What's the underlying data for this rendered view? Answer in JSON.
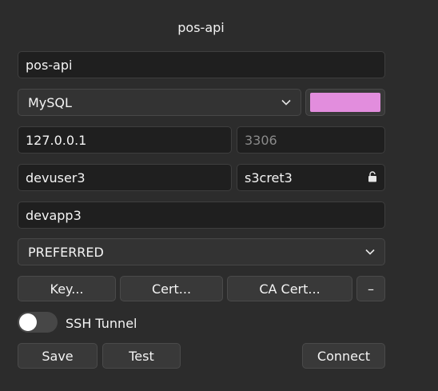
{
  "window": {
    "title": "pos-api"
  },
  "form": {
    "name": {
      "value": "pos-api"
    },
    "driver": {
      "selected": "MySQL",
      "icon": "chevron-down-icon"
    },
    "color": {
      "value": "#e28ddd"
    },
    "host": {
      "value": "127.0.0.1"
    },
    "port": {
      "placeholder": "3306",
      "value": ""
    },
    "user": {
      "value": "devuser3"
    },
    "password": {
      "value": "s3cret3",
      "icon": "lock-icon"
    },
    "database": {
      "value": "devapp3"
    },
    "ssl_mode": {
      "selected": "PREFERRED",
      "icon": "chevron-down-icon"
    },
    "ssl_buttons": {
      "key_label": "Key...",
      "cert_label": "Cert...",
      "ca_cert_label": "CA Cert...",
      "clear_label": "–"
    },
    "ssh_tunnel": {
      "label": "SSH Tunnel",
      "enabled": false
    }
  },
  "actions": {
    "save_label": "Save",
    "test_label": "Test",
    "connect_label": "Connect"
  }
}
